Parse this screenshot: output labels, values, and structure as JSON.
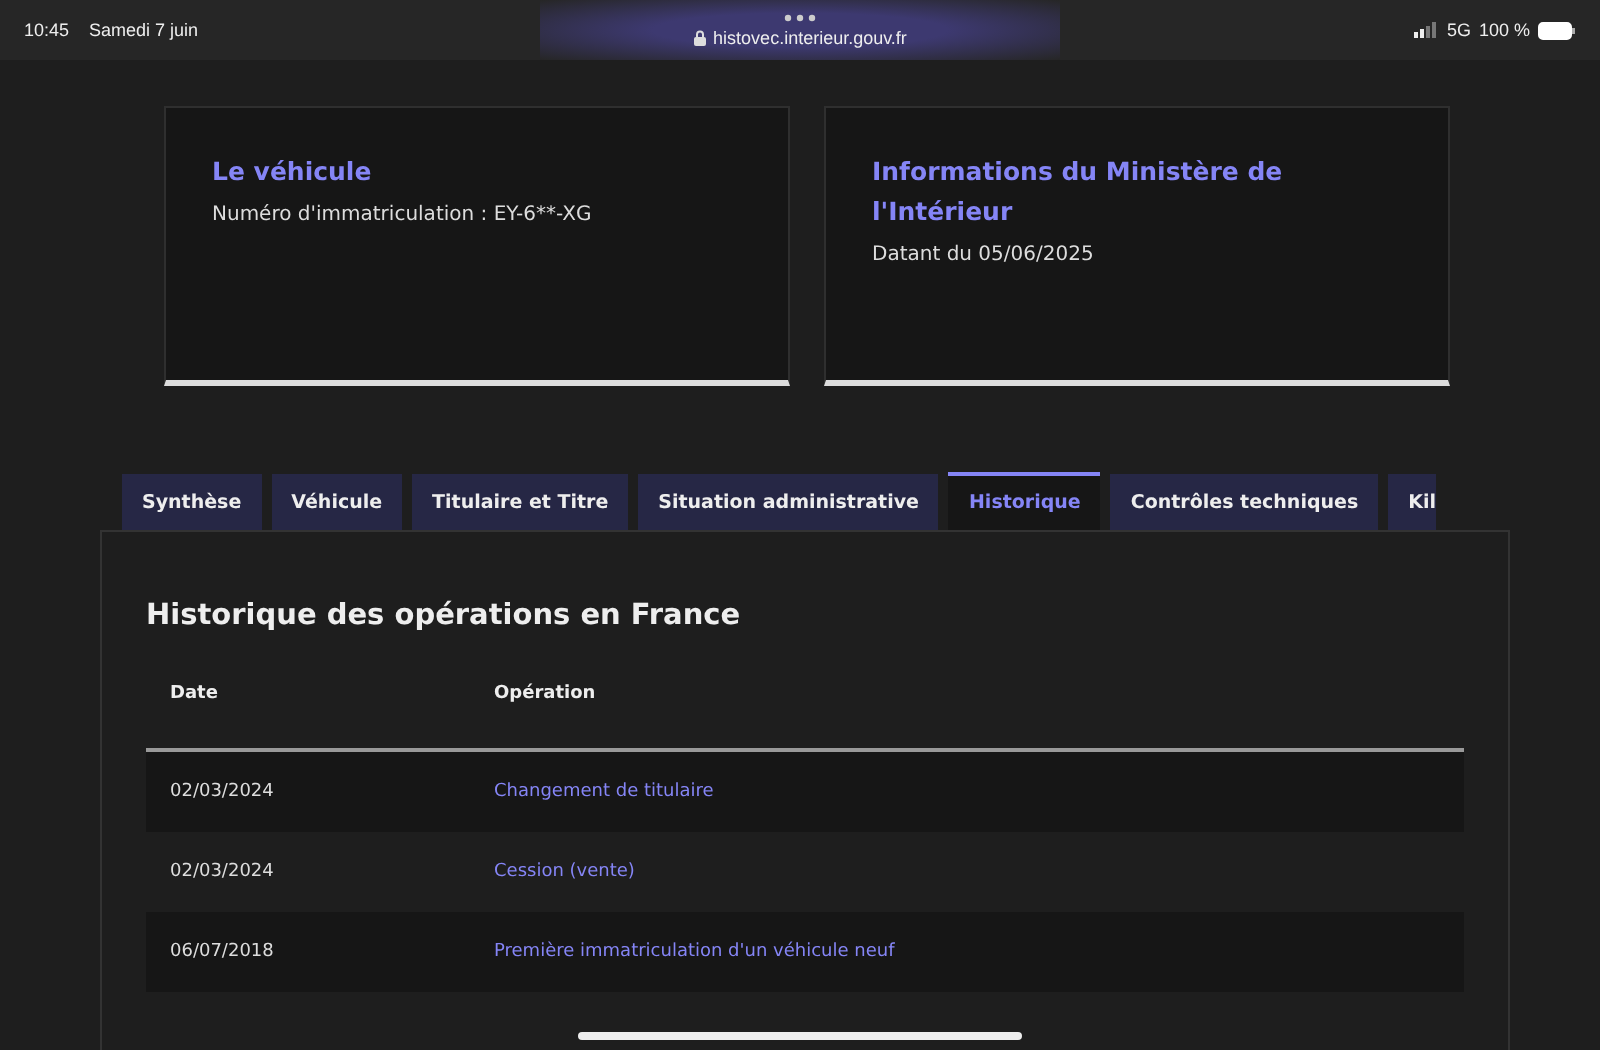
{
  "status_bar": {
    "time": "10:45",
    "date": "Samedi 7 juin",
    "url": "histovec.interieur.gouv.fr",
    "network": "5G",
    "battery": "100 %"
  },
  "cards": [
    {
      "title": "Le véhicule",
      "text": "Numéro d'immatriculation : EY-6**-XG"
    },
    {
      "title": "Informations du Ministère de l'Intérieur",
      "text": "Datant du 05/06/2025"
    }
  ],
  "tabs": [
    {
      "label": "Synthèse",
      "selected": false
    },
    {
      "label": "Véhicule",
      "selected": false
    },
    {
      "label": "Titulaire et Titre",
      "selected": false
    },
    {
      "label": "Situation administrative",
      "selected": false
    },
    {
      "label": "Historique",
      "selected": true
    },
    {
      "label": "Contrôles techniques",
      "selected": false
    },
    {
      "label": "Kil",
      "selected": false
    }
  ],
  "panel": {
    "title": "Historique des opérations en France",
    "table": {
      "columns": [
        "Date",
        "Opération"
      ],
      "rows": [
        {
          "date": "02/03/2024",
          "operation": "Changement de titulaire"
        },
        {
          "date": "02/03/2024",
          "operation": "Cession (vente)"
        },
        {
          "date": "06/07/2018",
          "operation": "Première immatriculation d'un véhicule neuf"
        }
      ]
    }
  }
}
